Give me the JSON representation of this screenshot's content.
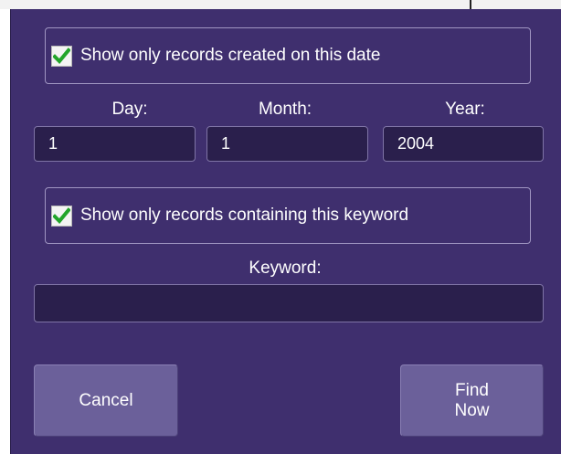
{
  "date_filter": {
    "checkbox_label": "Show only records created on this date",
    "checked": true,
    "day_label": "Day:",
    "day_value": "1",
    "month_label": "Month:",
    "month_value": "1",
    "year_label": "Year:",
    "year_value": "2004"
  },
  "keyword_filter": {
    "checkbox_label": "Show only records containing this keyword",
    "checked": true,
    "keyword_label": "Keyword:",
    "keyword_value": ""
  },
  "buttons": {
    "cancel_label": "Cancel",
    "find_now_line1": "Find",
    "find_now_line2": "Now"
  },
  "colors": {
    "panel_background": "#3f2f6e",
    "field_background": "#2a1f4c",
    "button_background": "#6b609a",
    "checkmark": "#22a52a"
  },
  "icons": {
    "checkbox_check": "check-icon"
  }
}
